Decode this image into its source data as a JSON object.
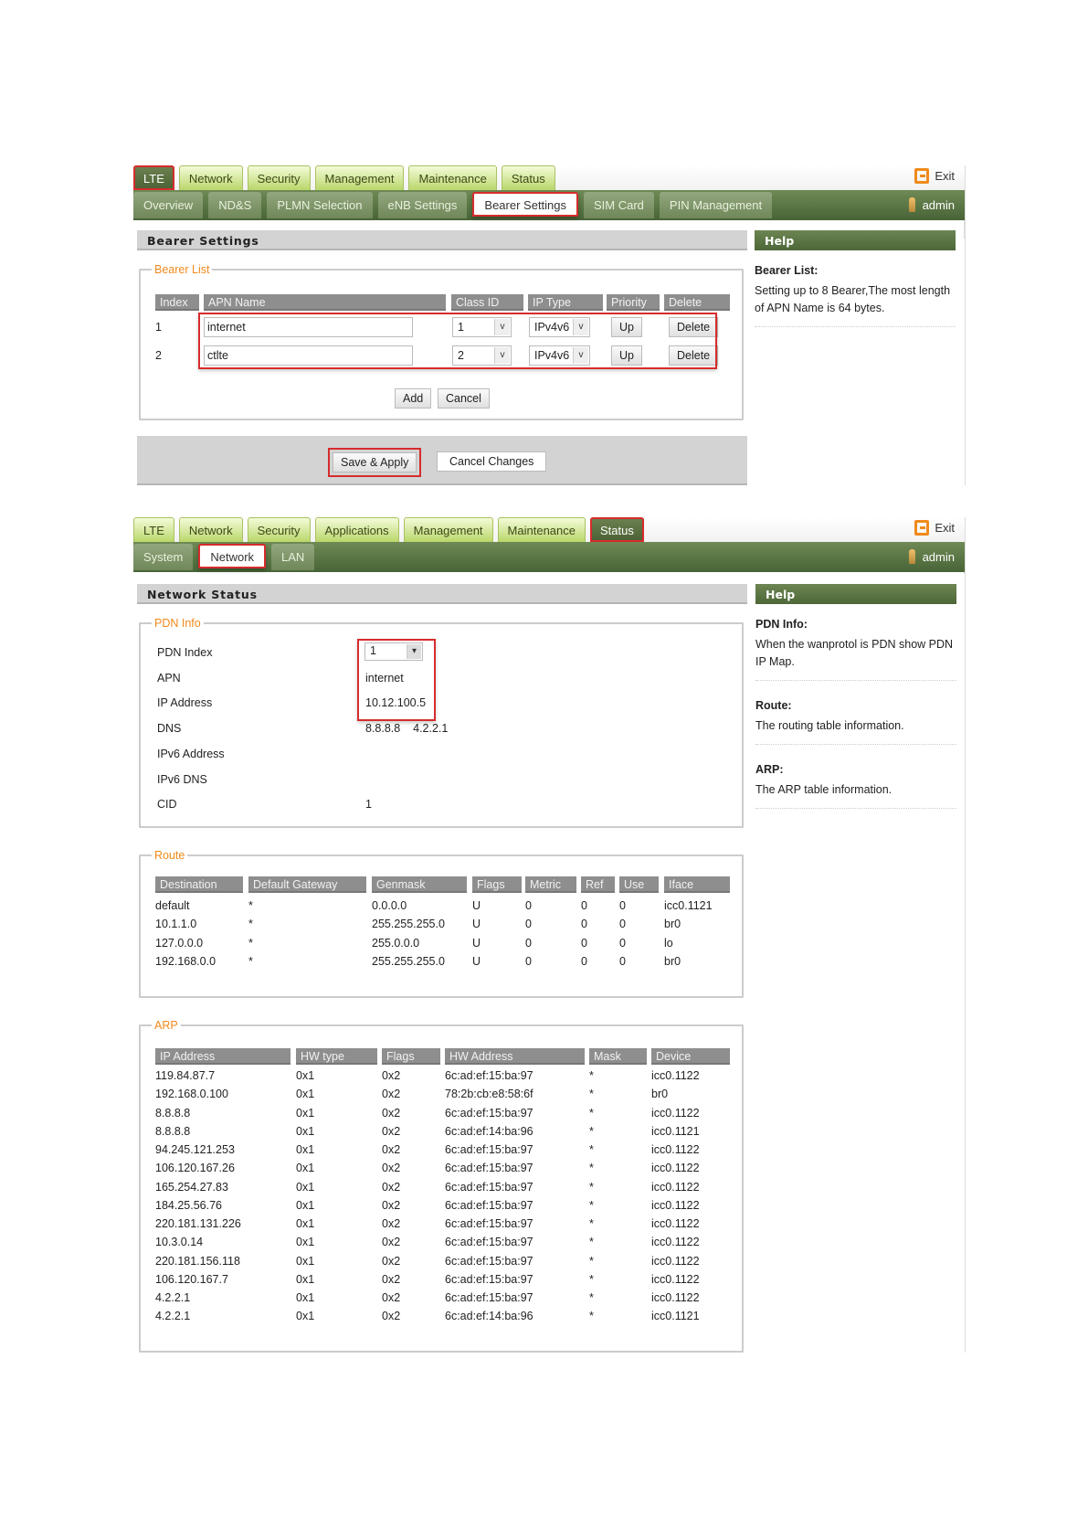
{
  "s1": {
    "tabs": [
      "LTE",
      "Network",
      "Security",
      "Management",
      "Maintenance",
      "Status"
    ],
    "subtabs": [
      "Overview",
      "ND&S",
      "PLMN Selection",
      "eNB Settings",
      "Bearer Settings",
      "SIM Card",
      "PIN Management"
    ],
    "exit": "Exit",
    "user": "admin",
    "title": "Bearer Settings",
    "help_title": "Help",
    "help": {
      "heading": "Bearer List:",
      "text": "Setting up to 8 Bearer,The most length of APN Name is 64 bytes."
    },
    "legend": "Bearer List",
    "columns": [
      "Index",
      "APN Name",
      "Class ID",
      "IP Type",
      "Priority",
      "Delete"
    ],
    "rows": [
      {
        "index": "1",
        "apn": "internet",
        "class_id": "1",
        "ip_type": "IPv4v6",
        "priority": "Up",
        "delete": "Delete"
      },
      {
        "index": "2",
        "apn": "ctlte",
        "class_id": "2",
        "ip_type": "IPv4v6",
        "priority": "Up",
        "delete": "Delete"
      }
    ],
    "add": "Add",
    "cancel": "Cancel",
    "save": "Save & Apply",
    "cancel_changes": "Cancel Changes"
  },
  "s2": {
    "tabs": [
      "LTE",
      "Network",
      "Security",
      "Applications",
      "Management",
      "Maintenance",
      "Status"
    ],
    "subtabs": [
      "System",
      "Network",
      "LAN"
    ],
    "exit": "Exit",
    "user": "admin",
    "title": "Network Status",
    "help_title": "Help",
    "help": [
      {
        "heading": "PDN Info:",
        "text": "When the wanprotol is PDN show PDN IP Map."
      },
      {
        "heading": "Route:",
        "text": "The routing table information."
      },
      {
        "heading": "ARP:",
        "text": "The ARP table information."
      }
    ],
    "pdn": {
      "legend": "PDN Info",
      "rows": [
        {
          "label": "PDN Index",
          "value": "1"
        },
        {
          "label": "APN",
          "value": "internet"
        },
        {
          "label": "IP Address",
          "value": "10.12.100.5"
        },
        {
          "label": "DNS",
          "value": "8.8.8.8    4.2.2.1"
        },
        {
          "label": "IPv6 Address",
          "value": ""
        },
        {
          "label": "IPv6 DNS",
          "value": ""
        },
        {
          "label": "CID",
          "value": "1"
        }
      ]
    },
    "route": {
      "legend": "Route",
      "columns": [
        "Destination",
        "Default Gateway",
        "Genmask",
        "Flags",
        "Metric",
        "Ref",
        "Use",
        "Iface"
      ],
      "rows": [
        [
          "default",
          "*",
          "0.0.0.0",
          "U",
          "0",
          "0",
          "0",
          "icc0.1121"
        ],
        [
          "10.1.1.0",
          "*",
          "255.255.255.0",
          "U",
          "0",
          "0",
          "0",
          "br0"
        ],
        [
          "127.0.0.0",
          "*",
          "255.0.0.0",
          "U",
          "0",
          "0",
          "0",
          "lo"
        ],
        [
          "192.168.0.0",
          "*",
          "255.255.255.0",
          "U",
          "0",
          "0",
          "0",
          "br0"
        ]
      ]
    },
    "arp": {
      "legend": "ARP",
      "columns": [
        "IP Address",
        "HW type",
        "Flags",
        "HW Address",
        "Mask",
        "Device"
      ],
      "rows": [
        [
          "119.84.87.7",
          "0x1",
          "0x2",
          "6c:ad:ef:15:ba:97",
          "*",
          "icc0.1122"
        ],
        [
          "192.168.0.100",
          "0x1",
          "0x2",
          "78:2b:cb:e8:58:6f",
          "*",
          "br0"
        ],
        [
          "8.8.8.8",
          "0x1",
          "0x2",
          "6c:ad:ef:15:ba:97",
          "*",
          "icc0.1122"
        ],
        [
          "8.8.8.8",
          "0x1",
          "0x2",
          "6c:ad:ef:14:ba:96",
          "*",
          "icc0.1121"
        ],
        [
          "94.245.121.253",
          "0x1",
          "0x2",
          "6c:ad:ef:15:ba:97",
          "*",
          "icc0.1122"
        ],
        [
          "106.120.167.26",
          "0x1",
          "0x2",
          "6c:ad:ef:15:ba:97",
          "*",
          "icc0.1122"
        ],
        [
          "165.254.27.83",
          "0x1",
          "0x2",
          "6c:ad:ef:15:ba:97",
          "*",
          "icc0.1122"
        ],
        [
          "184.25.56.76",
          "0x1",
          "0x2",
          "6c:ad:ef:15:ba:97",
          "*",
          "icc0.1122"
        ],
        [
          "220.181.131.226",
          "0x1",
          "0x2",
          "6c:ad:ef:15:ba:97",
          "*",
          "icc0.1122"
        ],
        [
          "10.3.0.14",
          "0x1",
          "0x2",
          "6c:ad:ef:15:ba:97",
          "*",
          "icc0.1122"
        ],
        [
          "220.181.156.118",
          "0x1",
          "0x2",
          "6c:ad:ef:15:ba:97",
          "*",
          "icc0.1122"
        ],
        [
          "106.120.167.7",
          "0x1",
          "0x2",
          "6c:ad:ef:15:ba:97",
          "*",
          "icc0.1122"
        ],
        [
          "4.2.2.1",
          "0x1",
          "0x2",
          "6c:ad:ef:15:ba:97",
          "*",
          "icc0.1122"
        ],
        [
          "4.2.2.1",
          "0x1",
          "0x2",
          "6c:ad:ef:14:ba:96",
          "*",
          "icc0.1121"
        ]
      ]
    }
  }
}
